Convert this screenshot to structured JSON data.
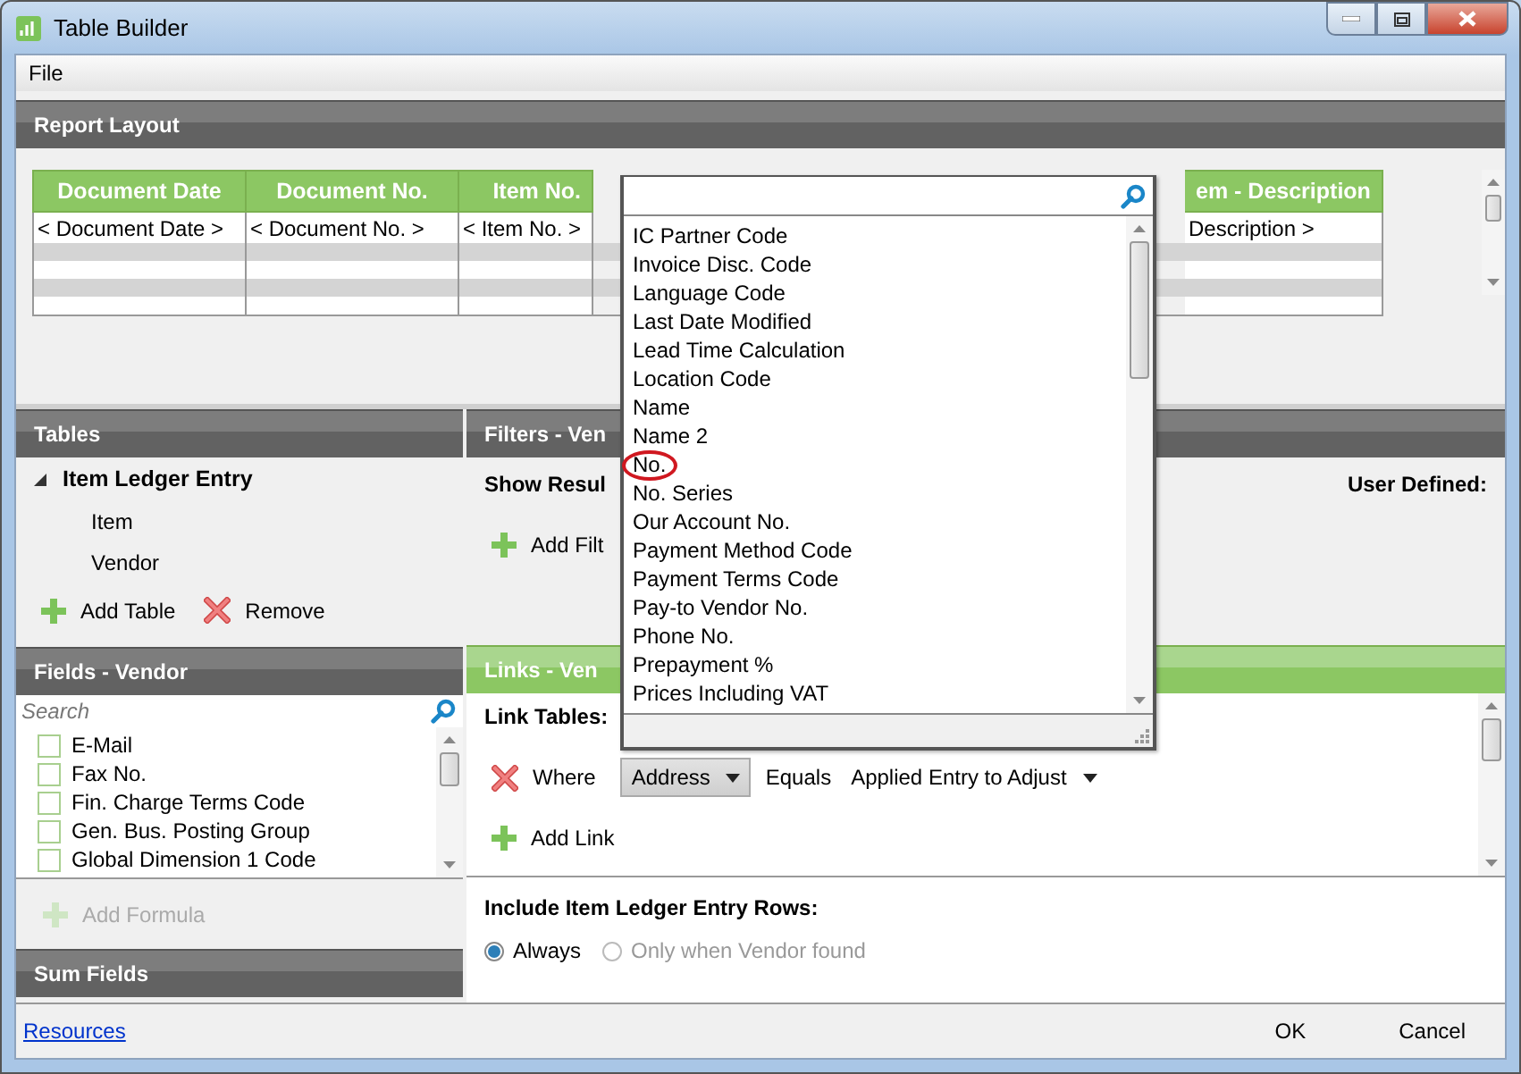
{
  "window": {
    "title": "Table Builder"
  },
  "menu": [
    "File"
  ],
  "report_layout": {
    "title": "Report Layout",
    "columns": [
      {
        "header": "Document Date",
        "cell": "< Document Date >"
      },
      {
        "header": "Document No.",
        "cell": "< Document No. >"
      },
      {
        "header": "Item No.",
        "cell": "< Item No. >"
      },
      {
        "header": "em - Description",
        "cell": "Description >"
      }
    ]
  },
  "tables": {
    "title": "Tables",
    "items": [
      {
        "label": "Item Ledger Entry",
        "expanded": true,
        "children": [
          {
            "label": "Item"
          },
          {
            "label": "Vendor"
          }
        ]
      }
    ],
    "actions": [
      {
        "kind": "add",
        "label": "Add Table"
      },
      {
        "kind": "remove",
        "label": "Remove"
      }
    ]
  },
  "fields": {
    "title": "Fields - Vendor",
    "search": {
      "placeholder": "Search"
    },
    "items": [
      {
        "label": "E-Mail",
        "checked": false
      },
      {
        "label": "Fax No.",
        "checked": false
      },
      {
        "label": "Fin. Charge Terms Code",
        "checked": false
      },
      {
        "label": "Gen. Bus. Posting Group",
        "checked": false
      },
      {
        "label": "Global Dimension 1 Code",
        "checked": false
      }
    ],
    "add_formula": {
      "label": "Add Formula",
      "disabled": true
    }
  },
  "sum_fields": {
    "title": "Sum Fields"
  },
  "filters": {
    "title": "Filters - Ven",
    "show_results": "Show Resul",
    "user_defined": "User Defined:",
    "add_filter": "Add Filt"
  },
  "links": {
    "title": "Links - Ven",
    "link_tables": "Link Tables:",
    "rows": [
      {
        "where": "Where",
        "field": "Address",
        "operator": "Equals",
        "target": "Applied Entry to Adjust"
      }
    ],
    "add_link": "Add Link"
  },
  "include": {
    "title": "Include Item Ledger Entry Rows:",
    "options": [
      {
        "label": "Always",
        "selected": true,
        "disabled": false
      },
      {
        "label": "Only when Vendor found",
        "selected": false,
        "disabled": true
      }
    ]
  },
  "field_picker": {
    "items": [
      {
        "label": "IC Partner Code",
        "circled": false
      },
      {
        "label": "Invoice Disc. Code",
        "circled": false
      },
      {
        "label": "Language Code",
        "circled": false
      },
      {
        "label": "Last Date Modified",
        "circled": false
      },
      {
        "label": "Lead Time Calculation",
        "circled": false
      },
      {
        "label": "Location Code",
        "circled": false
      },
      {
        "label": "Name",
        "circled": false
      },
      {
        "label": "Name 2",
        "circled": false
      },
      {
        "label": "No.",
        "circled": true
      },
      {
        "label": "No. Series",
        "circled": false
      },
      {
        "label": "Our Account No.",
        "circled": false
      },
      {
        "label": "Payment Method Code",
        "circled": false
      },
      {
        "label": "Payment Terms Code",
        "circled": false
      },
      {
        "label": "Pay-to Vendor No.",
        "circled": false
      },
      {
        "label": "Phone No.",
        "circled": false
      },
      {
        "label": "Prepayment %",
        "circled": false
      },
      {
        "label": "Prices Including VAT",
        "circled": false
      }
    ]
  },
  "footer": {
    "link": "Resources",
    "buttons": [
      "OK",
      "Cancel"
    ]
  }
}
